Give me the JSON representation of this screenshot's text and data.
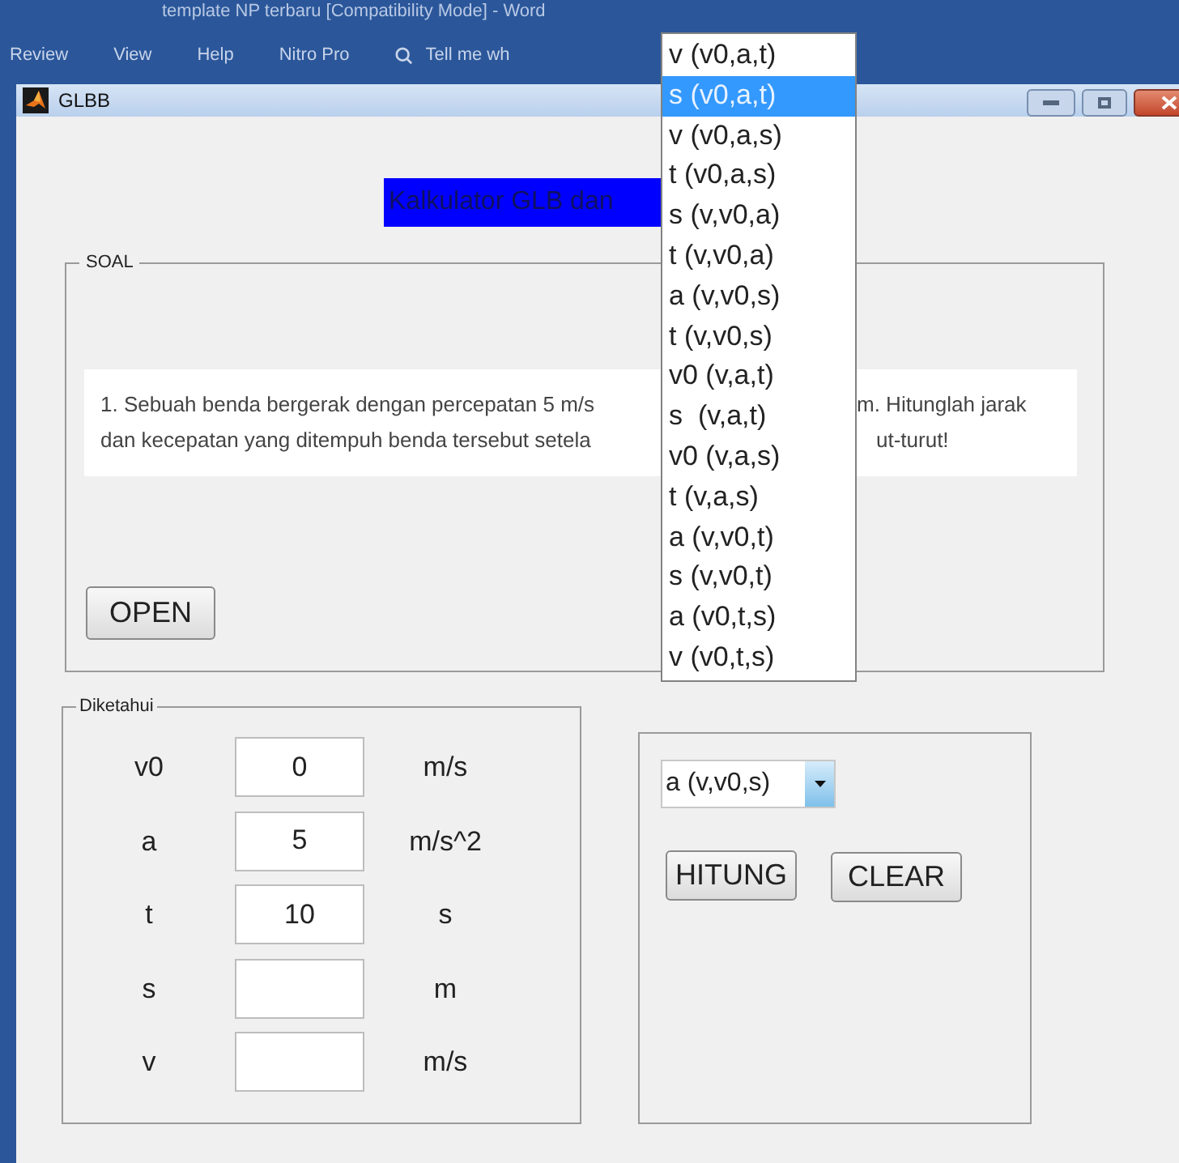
{
  "background_app": {
    "title": "template NP terbaru [Compatibility Mode] - Word",
    "menu": [
      "Review",
      "View",
      "Help",
      "Nitro Pro"
    ],
    "tell_me": "Tell me wh"
  },
  "window": {
    "title": "GLBB"
  },
  "heading": "Kalkulator GLB dan",
  "soal": {
    "legend": "SOAL",
    "question_left": [
      "1. Sebuah benda bergerak dengan percepatan 5 m/s",
      "dan kecepatan yang ditempuh benda tersebut setela"
    ],
    "question_right": [
      "m. Hitunglah jarak",
      "ut-turut!"
    ],
    "open_button": "OPEN"
  },
  "diketahui": {
    "legend": "Diketahui",
    "rows": [
      {
        "label": "v0",
        "value": "0",
        "unit": "m/s"
      },
      {
        "label": "a",
        "value": "5",
        "unit": "m/s^2"
      },
      {
        "label": "t",
        "value": "10",
        "unit": "s"
      },
      {
        "label": "s",
        "unit": "m"
      },
      {
        "label": "v",
        "unit": "m/s"
      }
    ]
  },
  "formula_select": {
    "value": "a (v,v0,s)",
    "options": [
      {
        "label": "v (v0,a,t)",
        "highlighted": false
      },
      {
        "label": "s (v0,a,t)",
        "highlighted": true
      },
      {
        "label": "v (v0,a,s)",
        "highlighted": false
      },
      {
        "label": "t (v0,a,s)",
        "highlighted": false
      },
      {
        "label": "s (v,v0,a)",
        "highlighted": false
      },
      {
        "label": "t (v,v0,a)",
        "highlighted": false
      },
      {
        "label": "a (v,v0,s)",
        "highlighted": false
      },
      {
        "label": "t (v,v0,s)",
        "highlighted": false
      },
      {
        "label": "v0 (v,a,t)",
        "highlighted": false
      },
      {
        "label": "s  (v,a,t)",
        "highlighted": false
      },
      {
        "label": "v0 (v,a,s)",
        "highlighted": false
      },
      {
        "label": "t (v,a,s)",
        "highlighted": false
      },
      {
        "label": "a (v,v0,t)",
        "highlighted": false
      },
      {
        "label": "s (v,v0,t)",
        "highlighted": false
      },
      {
        "label": "a (v0,t,s)",
        "highlighted": false
      },
      {
        "label": "v (v0,t,s)",
        "highlighted": false
      }
    ]
  },
  "buttons": [
    "HITUNG",
    "CLEAR"
  ]
}
